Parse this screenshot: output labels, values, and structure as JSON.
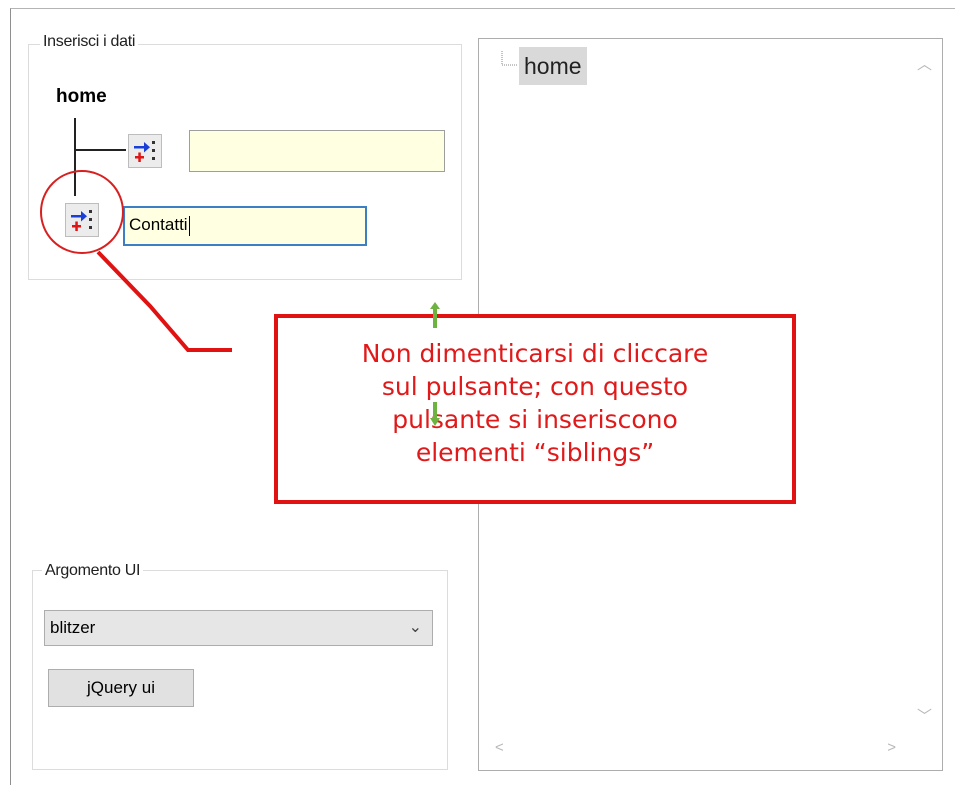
{
  "group_inserisci": {
    "legend": "Inserisci i dati",
    "root_label": "home",
    "child_input_value": "",
    "sibling_input_value": "Contatti"
  },
  "group_argomento": {
    "legend": "Argomento UI",
    "select_value": "blitzer",
    "button_label": "jQuery ui"
  },
  "tree": {
    "nodes": [
      "home"
    ]
  },
  "callout": {
    "lines": [
      "Non dimenticarsi di cliccare",
      "sul pulsante; con questo",
      "pulsante si inseriscono",
      "elementi “siblings”"
    ]
  },
  "icons": {
    "add_child": "add-child-node-icon",
    "add_sibling": "add-sibling-node-icon",
    "move_up": "arrow-up-icon",
    "move_down": "arrow-down-icon",
    "dropdown": "chevron-down-icon"
  },
  "colors": {
    "annotation_red": "#e01212",
    "input_background": "#ffffe1",
    "focus_border": "#3c7fc4",
    "arrow_green": "#6db33f"
  }
}
